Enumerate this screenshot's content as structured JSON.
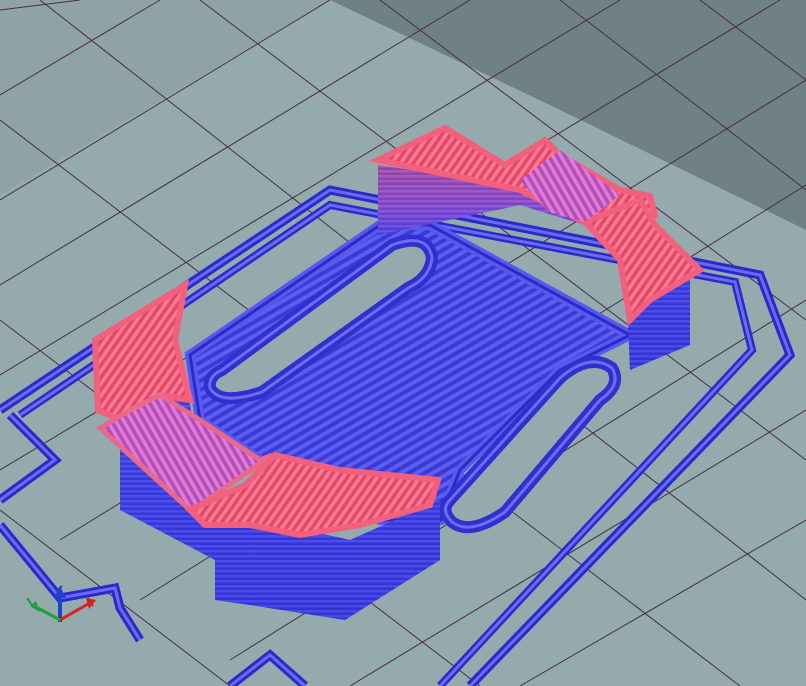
{
  "viewer": {
    "background_color": "#8a9ea2",
    "bed_color": "#93a9ac",
    "bed_edge_color": "#6a7d80",
    "grid_color": "#4a2c48",
    "low_layer_color": "#4a4aea",
    "high_layer_color": "#ec5a78",
    "mid_layer_color": "#c458c0"
  },
  "axis_gizmo": {
    "x_color": "#d82020",
    "y_color": "#20a040",
    "z_color": "#2040d0"
  }
}
